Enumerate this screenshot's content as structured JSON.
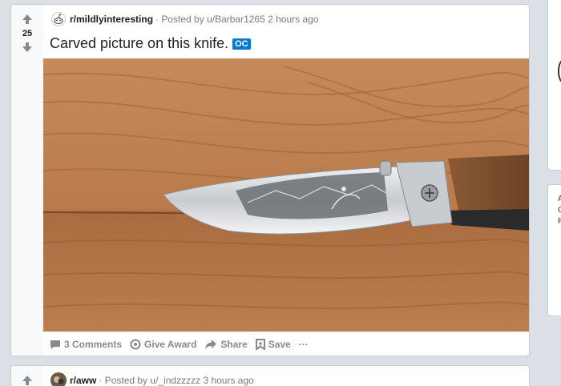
{
  "post1": {
    "score": "25",
    "subreddit": "r/mildlyinteresting",
    "posted_by": "· Posted by u/Barbar1265",
    "time": "2 hours ago",
    "title": "Carved picture on this knife.",
    "flair": "OC",
    "actions": {
      "comments": "3 Comments",
      "award": "Give Award",
      "share": "Share",
      "save": "Save",
      "more": "···"
    }
  },
  "post2": {
    "subreddit": "r/aww",
    "posted_by": "· Posted by u/_indzzzzz",
    "time": "3 hours ago"
  },
  "sidebar": {
    "letters": [
      "A",
      "C",
      "F"
    ]
  },
  "colors": {
    "accent": "#0079d3",
    "background": "#dae0e6",
    "meta_text": "#787c7e"
  }
}
